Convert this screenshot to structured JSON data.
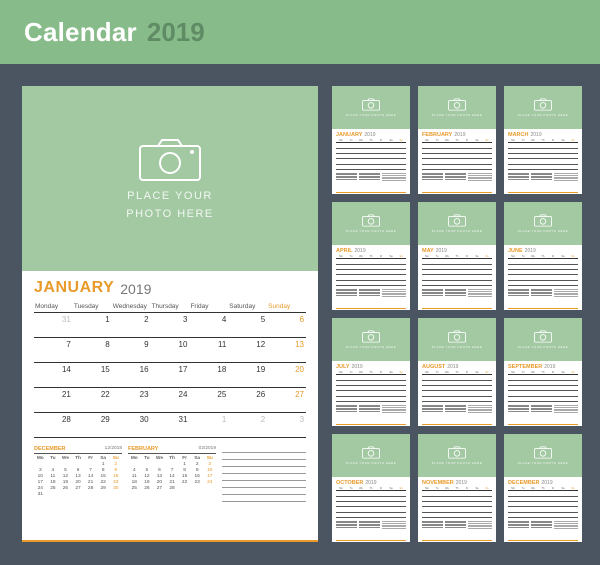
{
  "banner": {
    "title_word": "Calendar",
    "title_year": "2019"
  },
  "accent_color": "#e89a2b",
  "photo_placeholder": {
    "line1": "PLACE YOUR",
    "line2": "PHOTO HERE"
  },
  "main_page": {
    "month": "JANUARY",
    "year": "2019",
    "dow": [
      "Monday",
      "Tuesday",
      "Wednesday",
      "Thursday",
      "Friday",
      "Saturday",
      "Sunday"
    ],
    "rows": [
      [
        {
          "n": "31",
          "o": true
        },
        {
          "n": "1"
        },
        {
          "n": "2"
        },
        {
          "n": "3"
        },
        {
          "n": "4"
        },
        {
          "n": "5"
        },
        {
          "n": "6",
          "s": true
        }
      ],
      [
        {
          "n": "7"
        },
        {
          "n": "8"
        },
        {
          "n": "9"
        },
        {
          "n": "10"
        },
        {
          "n": "11"
        },
        {
          "n": "12"
        },
        {
          "n": "13",
          "s": true
        }
      ],
      [
        {
          "n": "14"
        },
        {
          "n": "15"
        },
        {
          "n": "16"
        },
        {
          "n": "17"
        },
        {
          "n": "18"
        },
        {
          "n": "19"
        },
        {
          "n": "20",
          "s": true
        }
      ],
      [
        {
          "n": "21"
        },
        {
          "n": "22"
        },
        {
          "n": "23"
        },
        {
          "n": "24"
        },
        {
          "n": "25"
        },
        {
          "n": "26"
        },
        {
          "n": "27",
          "s": true
        }
      ],
      [
        {
          "n": "28"
        },
        {
          "n": "29"
        },
        {
          "n": "30"
        },
        {
          "n": "31"
        },
        {
          "n": "1",
          "o": true
        },
        {
          "n": "2",
          "o": true
        },
        {
          "n": "3",
          "o": true,
          "s": true
        }
      ]
    ],
    "mini_prev": {
      "name": "DECEMBER",
      "label": "12/2018",
      "dow": [
        "Mo",
        "Tu",
        "We",
        "Th",
        "Fr",
        "Sa",
        "Su"
      ],
      "rows": [
        [
          "",
          "",
          "",
          "",
          "",
          "1",
          "2"
        ],
        [
          "3",
          "4",
          "5",
          "6",
          "7",
          "8",
          "9"
        ],
        [
          "10",
          "11",
          "12",
          "13",
          "14",
          "15",
          "16"
        ],
        [
          "17",
          "18",
          "19",
          "20",
          "21",
          "22",
          "23"
        ],
        [
          "24",
          "25",
          "26",
          "27",
          "28",
          "29",
          "30"
        ],
        [
          "31",
          "",
          "",
          "",
          "",
          "",
          ""
        ]
      ]
    },
    "mini_next": {
      "name": "FEBRUARY",
      "label": "02/2019",
      "dow": [
        "Mo",
        "Tu",
        "We",
        "Th",
        "Fr",
        "Sa",
        "Su"
      ],
      "rows": [
        [
          "",
          "",
          "",
          "",
          "1",
          "2",
          "3"
        ],
        [
          "4",
          "5",
          "6",
          "7",
          "8",
          "9",
          "10"
        ],
        [
          "11",
          "12",
          "13",
          "14",
          "15",
          "16",
          "17"
        ],
        [
          "18",
          "19",
          "20",
          "21",
          "22",
          "23",
          "24"
        ],
        [
          "25",
          "26",
          "27",
          "28",
          "",
          "",
          ""
        ]
      ]
    }
  },
  "months": [
    {
      "name": "JANUARY",
      "year": "2019"
    },
    {
      "name": "FEBRUARY",
      "year": "2019"
    },
    {
      "name": "MARCH",
      "year": "2019"
    },
    {
      "name": "APRIL",
      "year": "2019"
    },
    {
      "name": "MAY",
      "year": "2019"
    },
    {
      "name": "JUNE",
      "year": "2019"
    },
    {
      "name": "JULY",
      "year": "2019"
    },
    {
      "name": "AUGUST",
      "year": "2019"
    },
    {
      "name": "SEPTEMBER",
      "year": "2019"
    },
    {
      "name": "OCTOBER",
      "year": "2019"
    },
    {
      "name": "NOVEMBER",
      "year": "2019"
    },
    {
      "name": "DECEMBER",
      "year": "2019"
    }
  ],
  "thumb_dow": [
    "Mo",
    "Tu",
    "We",
    "Th",
    "Fr",
    "Sa",
    "Su"
  ]
}
